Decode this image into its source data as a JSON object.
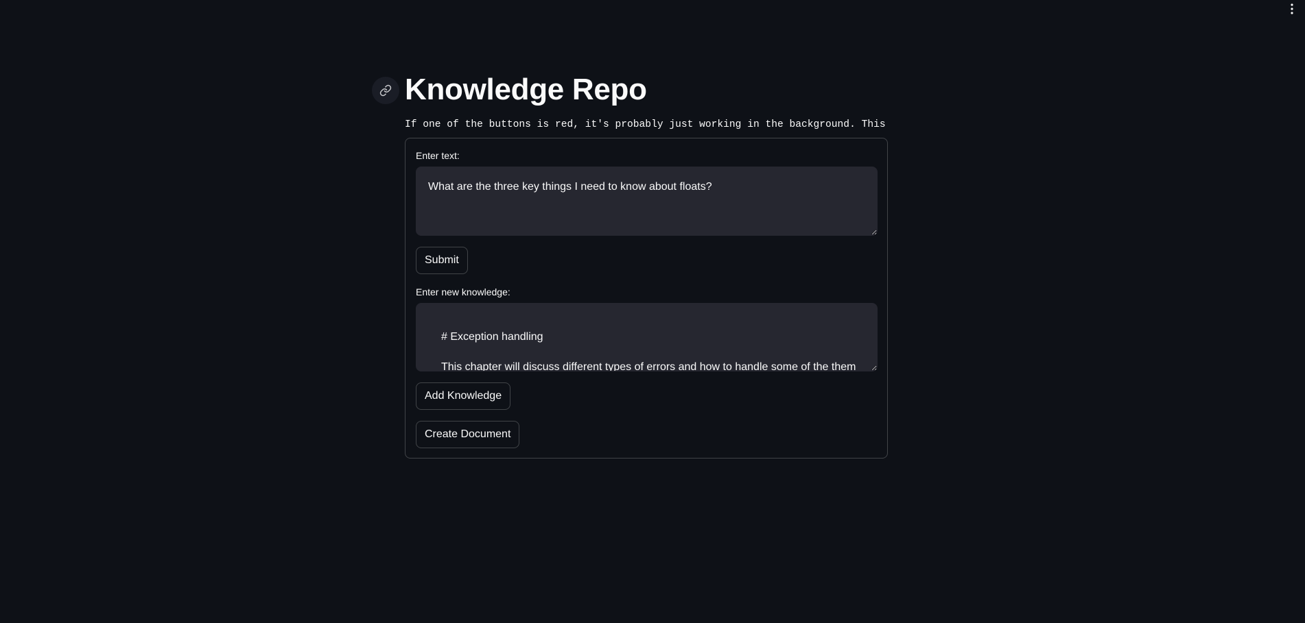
{
  "header": {
    "menu_icon": "vertical-ellipsis-icon"
  },
  "page": {
    "anchor_icon": "link-icon",
    "title": "Knowledge Repo",
    "notice": "If one of the buttons is red, it's probably just working in the background. This isn"
  },
  "form": {
    "query_label": "Enter text:",
    "query_value": "What are the three key things I need to know about floats?",
    "submit_label": "Submit",
    "knowledge_label": "Enter new knowledge:",
    "knowledge_value": "\n# Exception handling\n\nThis chapter will discuss different types of errors and how to handle some of the them within",
    "add_knowledge_label": "Add Knowledge",
    "create_document_label": "Create Document"
  },
  "colors": {
    "background": "#0e1117",
    "input_background": "#262730",
    "text": "#fafafa"
  }
}
